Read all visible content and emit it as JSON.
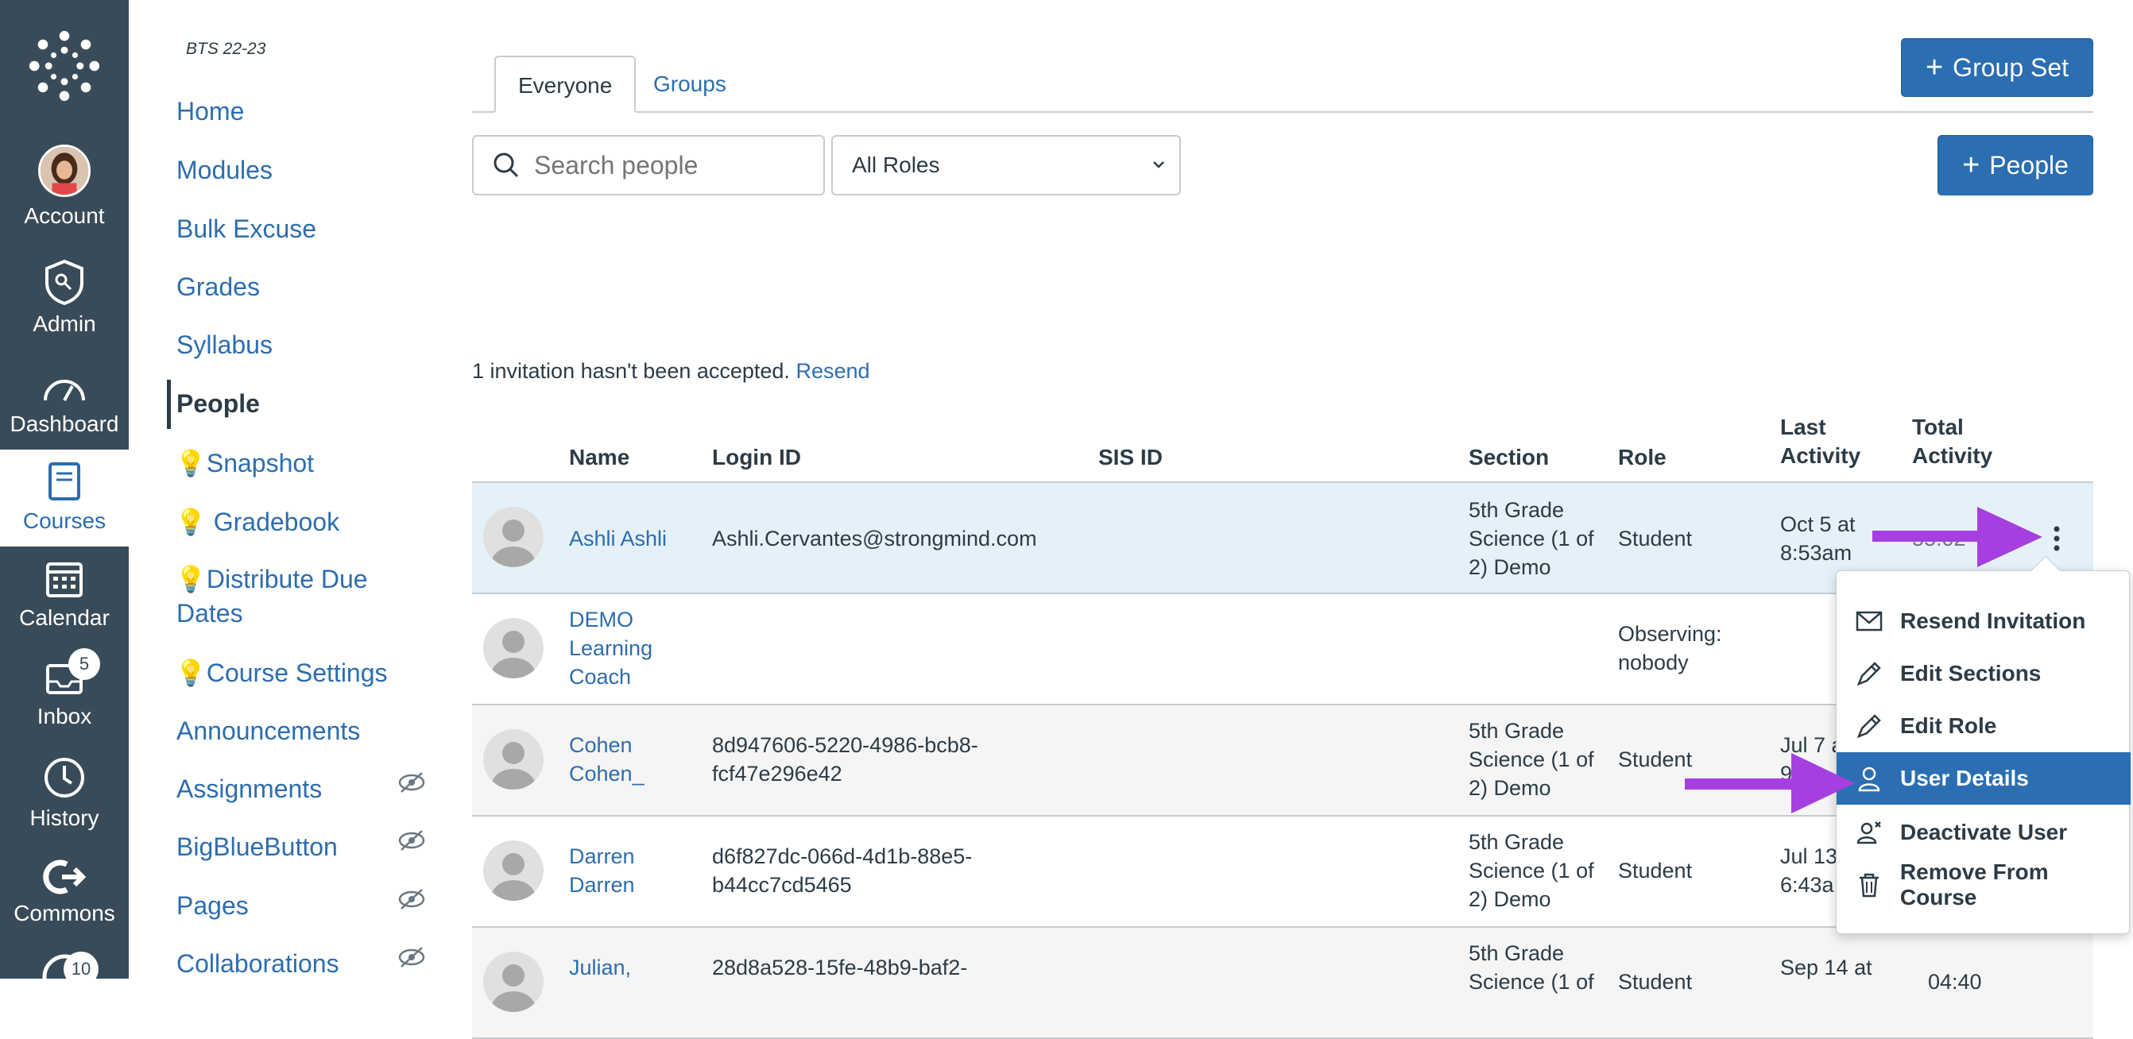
{
  "global_nav": {
    "items": [
      {
        "label": "Account",
        "icon": "account-avatar"
      },
      {
        "label": "Admin",
        "icon": "admin-shield-icon"
      },
      {
        "label": "Dashboard",
        "icon": "dashboard-icon"
      },
      {
        "label": "Courses",
        "icon": "courses-book-icon"
      },
      {
        "label": "Calendar",
        "icon": "calendar-icon"
      },
      {
        "label": "Inbox",
        "icon": "inbox-icon",
        "badge": "5"
      },
      {
        "label": "History",
        "icon": "history-clock-icon"
      },
      {
        "label": "Commons",
        "icon": "commons-icon"
      }
    ],
    "extra_badge": "10",
    "active": "Courses"
  },
  "course_nav": {
    "term": "BTS 22-23",
    "items": [
      {
        "label": "Home"
      },
      {
        "label": "Modules"
      },
      {
        "label": "Bulk Excuse"
      },
      {
        "label": "Grades"
      },
      {
        "label": "Syllabus"
      },
      {
        "label": "People"
      },
      {
        "label": "💡Snapshot"
      },
      {
        "label": "💡 Gradebook"
      },
      {
        "label": "💡Distribute Due",
        "label2": "Dates"
      },
      {
        "label": "💡Course Settings"
      },
      {
        "label": "Announcements"
      },
      {
        "label": "Assignments"
      },
      {
        "label": "BigBlueButton"
      },
      {
        "label": "Pages"
      },
      {
        "label": "Collaborations"
      }
    ]
  },
  "tabs": [
    "Everyone",
    "Groups"
  ],
  "buttons": {
    "group_set": "Group Set",
    "people": "People"
  },
  "search": {
    "placeholder": "Search people"
  },
  "role_filter": {
    "selected": "All Roles"
  },
  "invitation": {
    "text": "1 invitation hasn't been accepted.",
    "link": "Resend"
  },
  "table": {
    "headers": {
      "name": "Name",
      "login": "Login ID",
      "sis": "SIS ID",
      "section": "Section",
      "role": "Role",
      "last1": "Last",
      "last2": "Activity",
      "total1": "Total",
      "total2": "Activity"
    },
    "rows": [
      {
        "name1": "Ashli Ashli",
        "name2": "",
        "name3": "",
        "login1": "Ashli.Cervantes@strongmind.com",
        "login2": "",
        "sec1": "5th Grade",
        "sec2": "Science (1 of",
        "sec3": "2) Demo",
        "role1": "Student",
        "role2": "",
        "last1": "Oct 5 at",
        "last2": "8:53am",
        "total": "55:02"
      },
      {
        "name1": "DEMO",
        "name2": "Learning",
        "name3": "Coach",
        "login1": "",
        "login2": "",
        "sec1": "",
        "sec2": "",
        "sec3": "",
        "role1": "Observing:",
        "role2": "nobody",
        "last1": "",
        "last2": "",
        "total": ""
      },
      {
        "name1": "Cohen",
        "name2": "Cohen_",
        "name3": "",
        "login1": "8d947606-5220-4986-bcb8-",
        "login2": "fcf47e296e42",
        "sec1": "5th Grade",
        "sec2": "Science (1 of",
        "sec3": "2) Demo",
        "role1": "Student",
        "role2": "",
        "last1": "Jul 7 a",
        "last2": "9:",
        "total": ""
      },
      {
        "name1": "Darren",
        "name2": "Darren",
        "name3": "",
        "login1": "d6f827dc-066d-4d1b-88e5-",
        "login2": "b44cc7cd5465",
        "sec1": "5th Grade",
        "sec2": "Science (1 of",
        "sec3": "2) Demo",
        "role1": "Student",
        "role2": "",
        "last1": "Jul 13",
        "last2": "6:43a",
        "total": ""
      },
      {
        "name1": "Julian,",
        "name2": "",
        "name3": "",
        "login1": "28d8a528-15fe-48b9-baf2-",
        "login2": "",
        "sec1": "5th Grade",
        "sec2": "Science (1 of",
        "sec3": "",
        "role1": "Student",
        "role2": "",
        "last1": "Sep 14 at",
        "last2": "",
        "total": "04:40"
      }
    ]
  },
  "menu": {
    "items": [
      "Resend Invitation",
      "Edit Sections",
      "Edit Role",
      "User Details",
      "Deactivate User",
      "Remove From Course"
    ],
    "highlighted": "User Details"
  },
  "colors": {
    "nav_bg": "#394b58",
    "link": "#2d6dae",
    "button": "#2b6eb1",
    "row_highlight": "#e5f1f8",
    "arrow": "#a63fe0"
  }
}
